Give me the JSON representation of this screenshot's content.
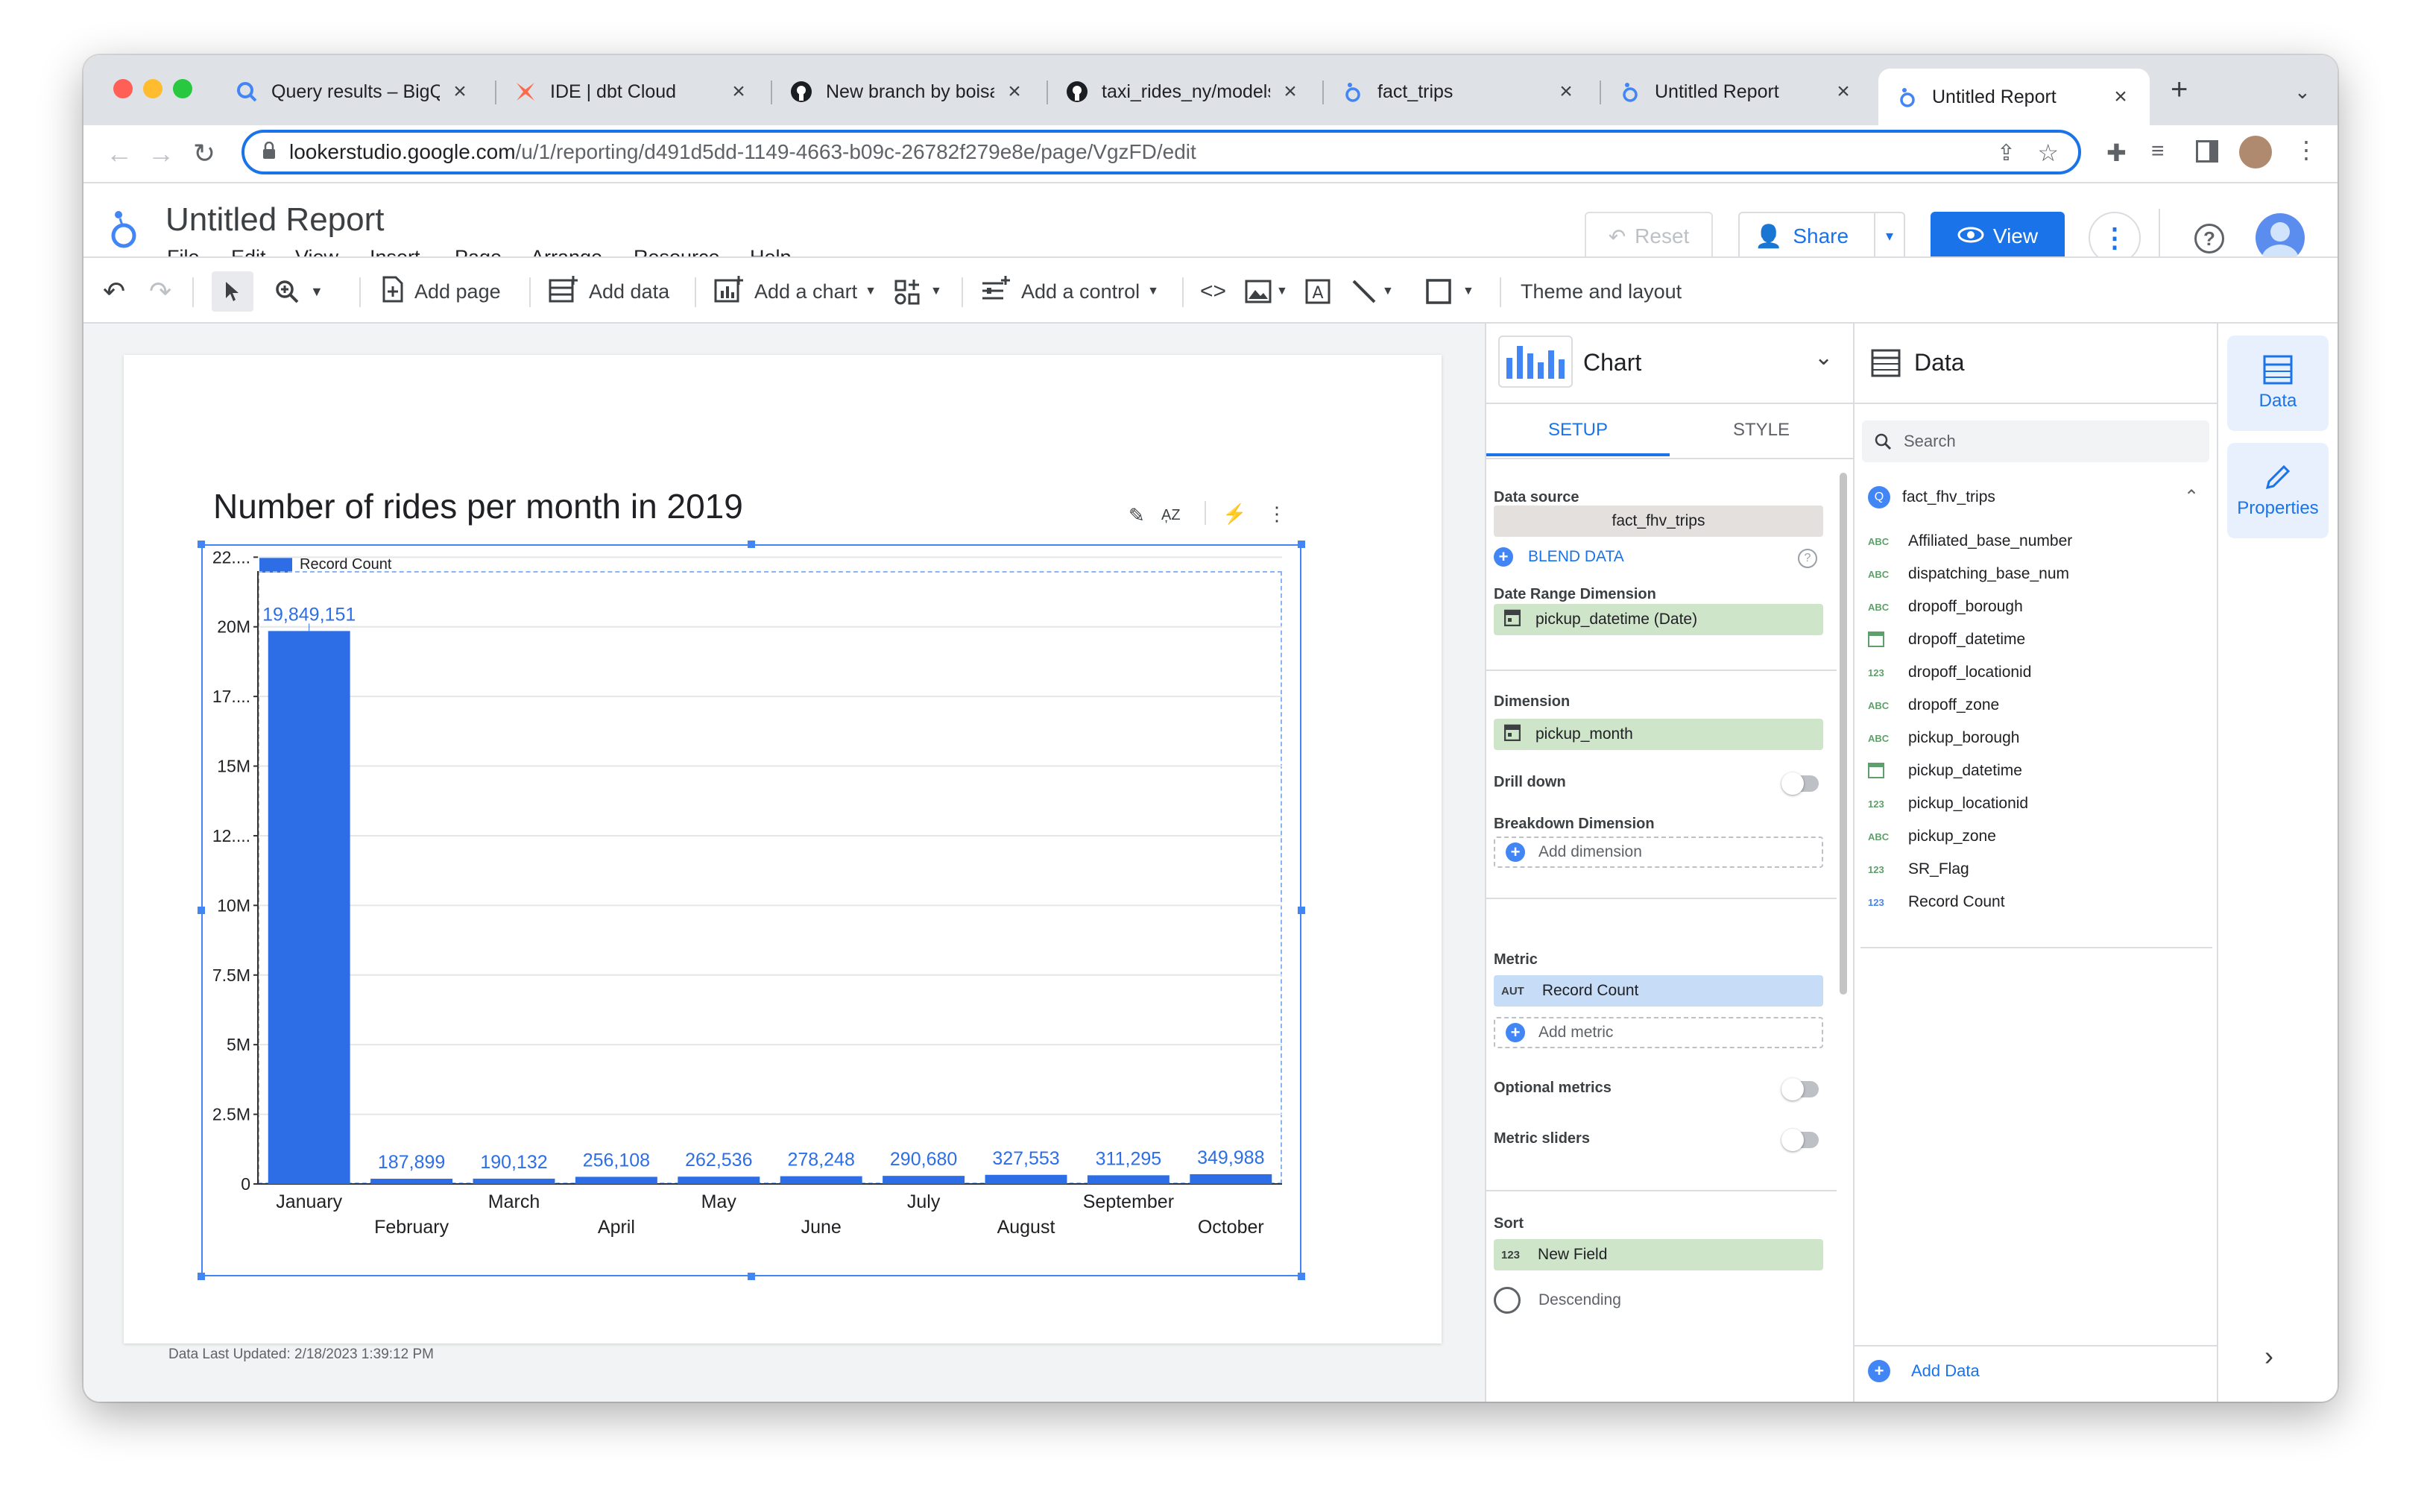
{
  "browser": {
    "tabs": [
      {
        "title": "Query results – BigQuery",
        "icon": "bigquery-icon"
      },
      {
        "title": "IDE | dbt Cloud",
        "icon": "dbt-icon"
      },
      {
        "title": "New branch by boisalai",
        "icon": "github-icon"
      },
      {
        "title": "taxi_rides_ny/models",
        "icon": "github-icon"
      },
      {
        "title": "fact_trips",
        "icon": "looker-icon"
      },
      {
        "title": "Untitled Report",
        "icon": "looker-icon"
      },
      {
        "title": "Untitled Report",
        "icon": "looker-icon",
        "active": true
      }
    ],
    "url_domain": "lookerstudio.google.com",
    "url_path": "/u/1/reporting/d491d5dd-1149-4663-b09c-26782f279e8e/page/VgzFD/edit"
  },
  "app": {
    "title": "Untitled Report",
    "menu": [
      "File",
      "Edit",
      "View",
      "Insert",
      "Page",
      "Arrange",
      "Resource",
      "Help"
    ],
    "reset_label": "Reset",
    "share_label": "Share",
    "view_label": "View"
  },
  "toolbar": {
    "add_page": "Add page",
    "add_data": "Add data",
    "add_chart": "Add a chart",
    "add_control": "Add a control",
    "theme_layout": "Theme and layout"
  },
  "report": {
    "data_last_updated": "Data Last Updated: 2/18/2023 1:39:12 PM"
  },
  "chart_data": {
    "type": "bar",
    "title": "Number of rides per month in 2019",
    "xlabel": "",
    "ylabel": "",
    "legend": "top-left",
    "grid": true,
    "ylim": [
      0,
      22000000
    ],
    "ytick_labels": [
      "0",
      "2.5M",
      "5M",
      "7.5M",
      "10M",
      "12....",
      "15M",
      "17....",
      "20M",
      "22...."
    ],
    "ytick_values": [
      0,
      2500000,
      5000000,
      7500000,
      10000000,
      12500000,
      15000000,
      17500000,
      20000000,
      22500000
    ],
    "categories": [
      "January",
      "February",
      "March",
      "April",
      "May",
      "June",
      "July",
      "August",
      "September",
      "October"
    ],
    "series": [
      {
        "name": "Record Count",
        "color": "#2d6ee6",
        "values": [
          19849151,
          187899,
          190132,
          256108,
          262536,
          278248,
          290680,
          327553,
          311295,
          349988
        ],
        "labels": [
          "19,849,151",
          "187,899",
          "190,132",
          "256,108",
          "262,536",
          "278,248",
          "290,680",
          "327,553",
          "311,295",
          "349,988"
        ]
      }
    ]
  },
  "setup_panel": {
    "header": "Chart",
    "tab_setup": "SETUP",
    "tab_style": "STYLE",
    "data_source_label": "Data source",
    "data_source": "fact_fhv_trips",
    "blend_data": "BLEND DATA",
    "date_range_label": "Date Range Dimension",
    "date_range_value": "pickup_datetime (Date)",
    "dimension_label": "Dimension",
    "dimension_value": "pickup_month",
    "drill_down": "Drill down",
    "breakdown_label": "Breakdown Dimension",
    "add_dimension": "Add dimension",
    "metric_label": "Metric",
    "metric_type": "AUT",
    "metric_value": "Record Count",
    "add_metric": "Add metric",
    "optional_metrics": "Optional metrics",
    "metric_sliders": "Metric sliders",
    "sort_label": "Sort",
    "sort_type": "123",
    "sort_value": "New Field",
    "descending": "Descending"
  },
  "data_panel": {
    "header": "Data",
    "search_placeholder": "Search",
    "source": "fact_fhv_trips",
    "fields": [
      {
        "type": "ABC",
        "name": "Affiliated_base_number"
      },
      {
        "type": "ABC",
        "name": "dispatching_base_num"
      },
      {
        "type": "ABC",
        "name": "dropoff_borough"
      },
      {
        "type": "date",
        "name": "dropoff_datetime"
      },
      {
        "type": "123",
        "name": "dropoff_locationid"
      },
      {
        "type": "ABC",
        "name": "dropoff_zone"
      },
      {
        "type": "ABC",
        "name": "pickup_borough"
      },
      {
        "type": "date",
        "name": "pickup_datetime"
      },
      {
        "type": "123",
        "name": "pickup_locationid"
      },
      {
        "type": "ABC",
        "name": "pickup_zone"
      },
      {
        "type": "123",
        "name": "SR_Flag"
      },
      {
        "type": "123",
        "name": "Record Count"
      }
    ],
    "add_data": "Add Data"
  },
  "rail": {
    "data": "Data",
    "properties": "Properties"
  }
}
